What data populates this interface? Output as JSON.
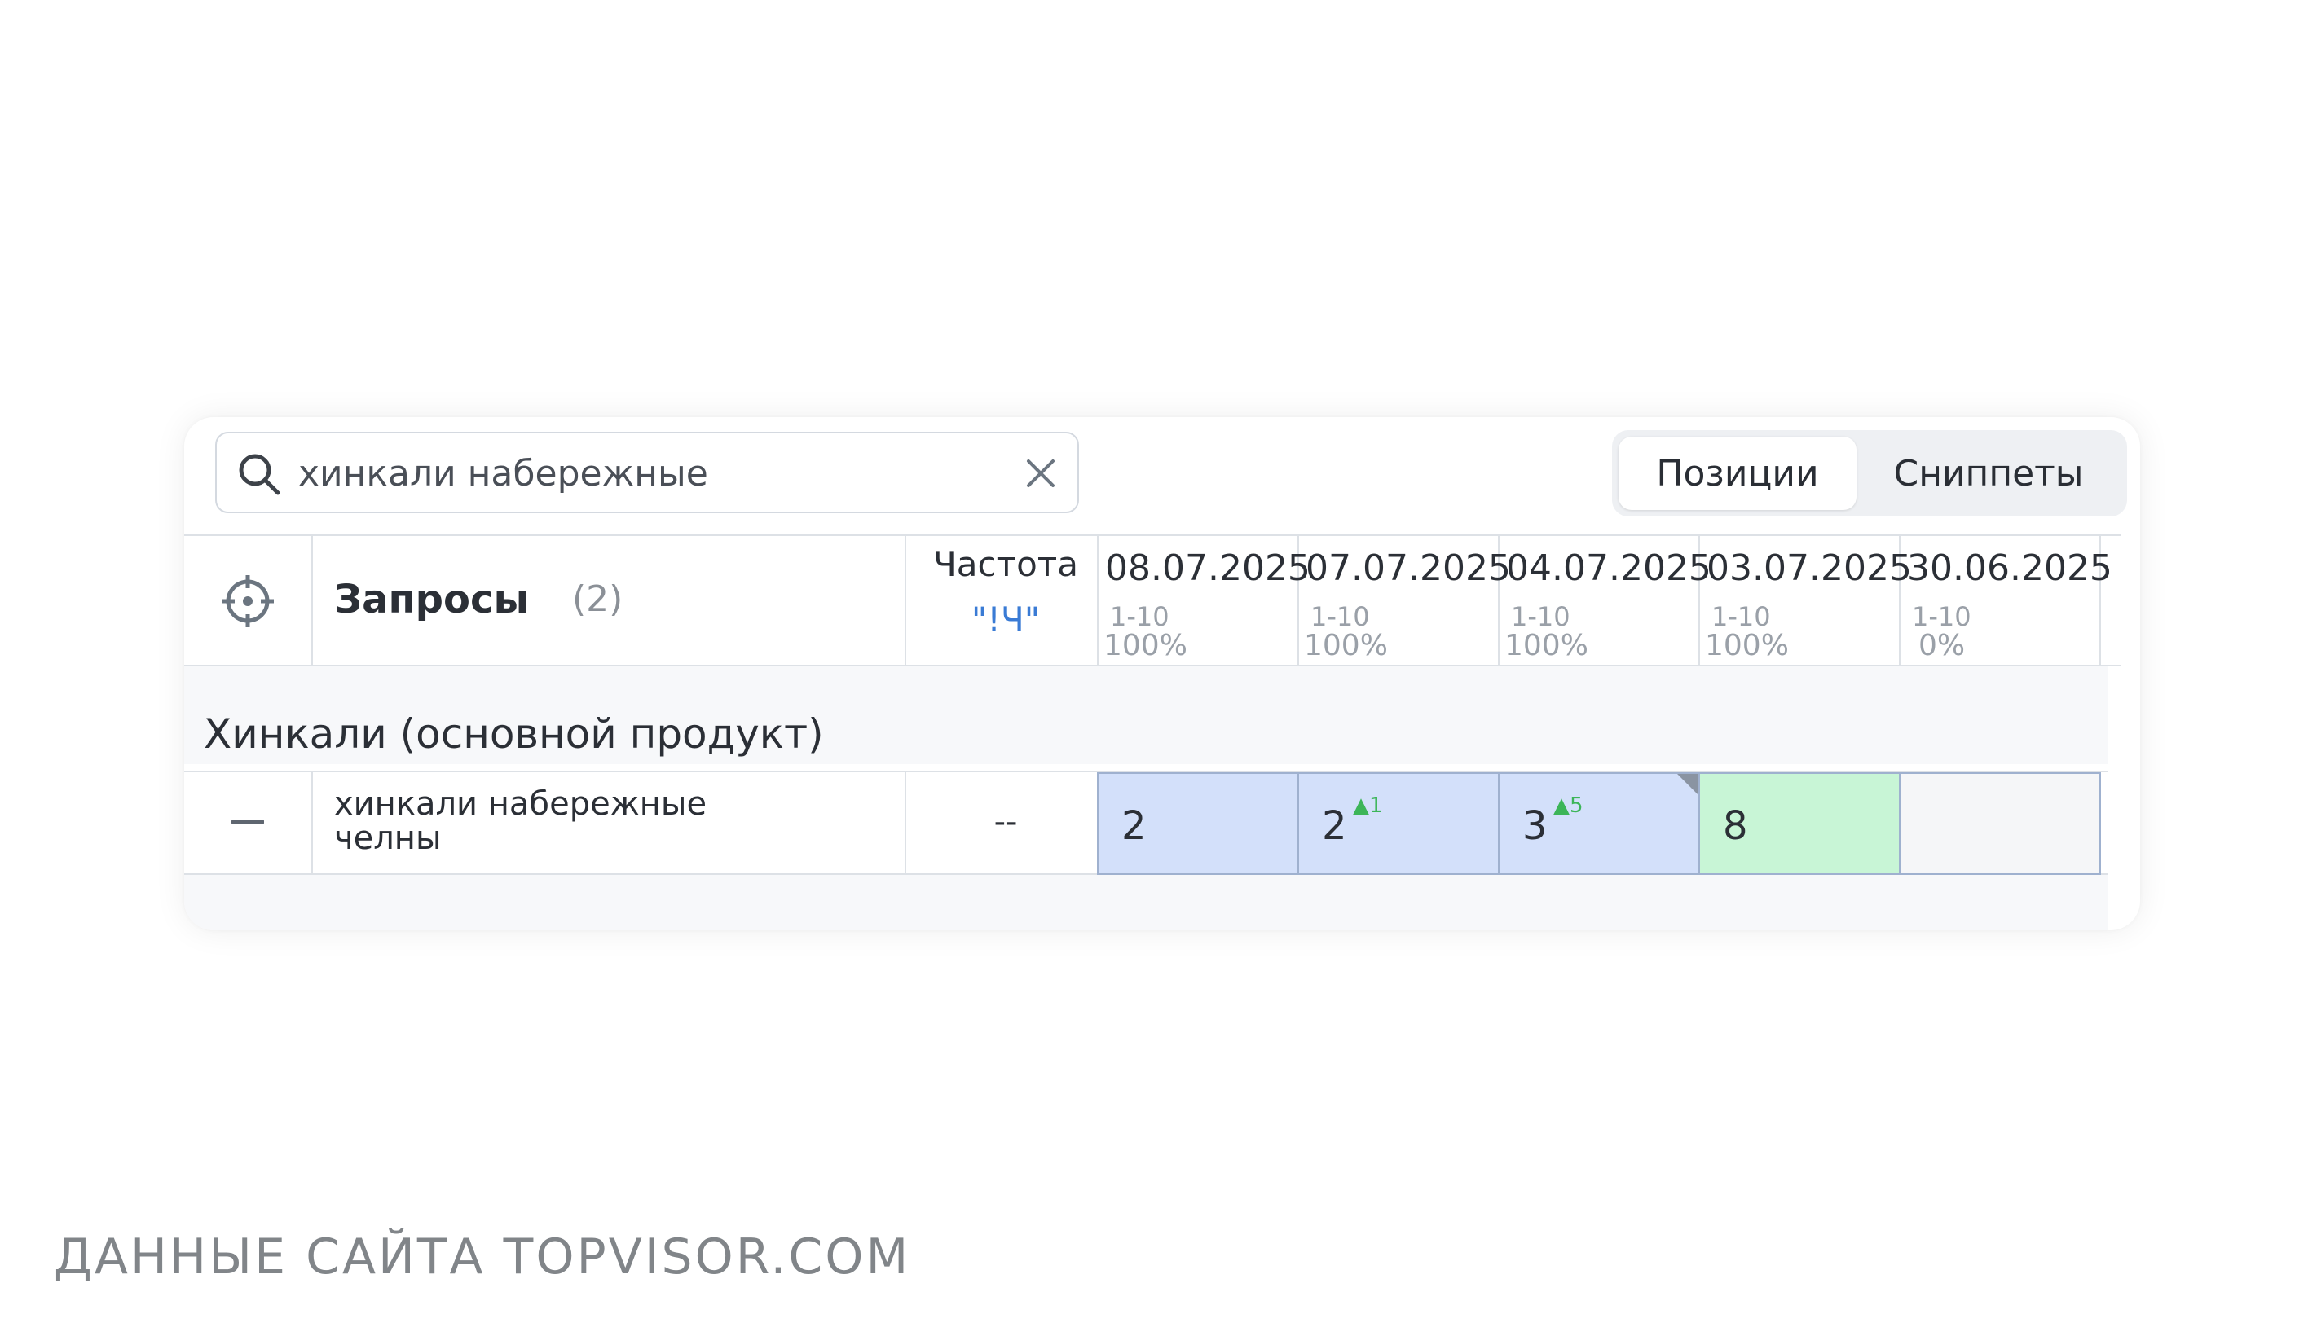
{
  "search": {
    "value": "хинкали набережные"
  },
  "view_toggle": {
    "active": "Позиции",
    "inactive": "Сниппеты"
  },
  "table": {
    "queries_title": "Запросы",
    "queries_count": "(2)",
    "frequency_label": "Частота",
    "frequency_type": "\"!Ч\"",
    "columns": [
      {
        "date": "08.07.2025",
        "range": "1-10",
        "percent": "100%"
      },
      {
        "date": "07.07.2025",
        "range": "1-10",
        "percent": "100%"
      },
      {
        "date": "04.07.2025",
        "range": "1-10",
        "percent": "100%"
      },
      {
        "date": "03.07.2025",
        "range": "1-10",
        "percent": "100%"
      },
      {
        "date": "30.06.2025",
        "range": "1-10",
        "percent": "0%"
      }
    ],
    "group_title": "Хинкали (основной продукт)",
    "row": {
      "keyword_line1": "хинкали набережные",
      "keyword_line2": "челны",
      "frequency": "--",
      "positions": [
        {
          "value": "2",
          "delta": "",
          "color": "#d3e0fa"
        },
        {
          "value": "2",
          "delta": "1",
          "color": "#d3e0fa"
        },
        {
          "value": "3",
          "delta": "5",
          "color": "#d3e0fa"
        },
        {
          "value": "8",
          "delta": "",
          "color": "#c8f5d6"
        },
        {
          "value": "",
          "delta": "",
          "color": "#f5f6f8"
        }
      ]
    }
  },
  "watermark": "ДАННЫЕ САЙТА TOPVISOR.COM",
  "colors": {
    "accent_blue": "#3a7bd5",
    "delta_green": "#3cb558"
  }
}
